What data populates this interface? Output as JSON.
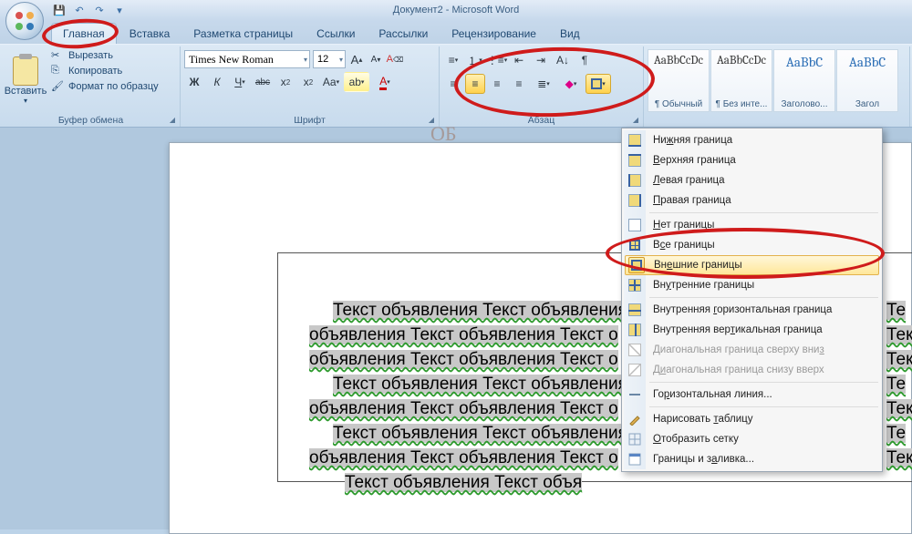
{
  "title": "Документ2 - Microsoft Word",
  "qat": {
    "save": "💾",
    "undo": "↶",
    "redo": "↷",
    "more": "▾",
    "spacer": "•"
  },
  "tabs": [
    "Главная",
    "Вставка",
    "Разметка страницы",
    "Ссылки",
    "Рассылки",
    "Рецензирование",
    "Вид"
  ],
  "active_tab": 0,
  "clipboard": {
    "paste": "Вставить",
    "cut": "Вырезать",
    "copy": "Копировать",
    "format_painter": "Формат по образцу",
    "label": "Буфер обмена"
  },
  "font": {
    "name": "Times New Roman",
    "size": "12",
    "grow": "A▴",
    "shrink": "A▾",
    "clear": "Aa",
    "bold": "Ж",
    "italic": "К",
    "underline": "Ч",
    "strike": "abc",
    "sub": "x₂",
    "sup": "x²",
    "case": "Aa",
    "highlight": "ab",
    "color": "A",
    "label": "Шрифт"
  },
  "para": {
    "label": "Абзац"
  },
  "styles": {
    "items": [
      {
        "preview": "AaBbCcDc",
        "label": "¶ Обычный"
      },
      {
        "preview": "AaBbCcDc",
        "label": "¶ Без инте..."
      },
      {
        "preview": "AaBbC",
        "label": "Заголово..."
      },
      {
        "preview": "AaBbC",
        "label": "Загол"
      }
    ]
  },
  "menu": {
    "items": [
      {
        "key": "bottom",
        "label_pre": "Ни",
        "label_u": "ж",
        "label_post": "няя граница"
      },
      {
        "key": "top",
        "label_pre": "",
        "label_u": "В",
        "label_post": "ерхняя граница"
      },
      {
        "key": "left",
        "label_pre": "",
        "label_u": "Л",
        "label_post": "евая граница"
      },
      {
        "key": "right",
        "label_pre": "",
        "label_u": "П",
        "label_post": "равая граница"
      },
      {
        "sep": true
      },
      {
        "key": "none",
        "label_pre": "",
        "label_u": "Н",
        "label_post": "ет границы"
      },
      {
        "key": "all",
        "label_pre": "В",
        "label_u": "с",
        "label_post": "е границы"
      },
      {
        "key": "outer",
        "label_pre": "Вн",
        "label_u": "е",
        "label_post": "шние границы",
        "hover": true
      },
      {
        "key": "inner",
        "label_pre": "Вн",
        "label_u": "у",
        "label_post": "тренние границы"
      },
      {
        "sep": true
      },
      {
        "key": "hmid",
        "label_pre": "Внутренняя ",
        "label_u": "г",
        "label_post": "оризонтальная граница"
      },
      {
        "key": "vmid",
        "label_pre": "Внутренняя вер",
        "label_u": "т",
        "label_post": "икальная граница"
      },
      {
        "key": "diagd",
        "label_pre": "Диагональная граница сверху вни",
        "label_u": "з",
        "label_post": "",
        "disabled": true
      },
      {
        "key": "diagu",
        "label_pre": "Д",
        "label_u": "и",
        "label_post": "агональная граница снизу вверх",
        "disabled": true
      },
      {
        "sep": true
      },
      {
        "key": "hline",
        "label_pre": "Го",
        "label_u": "р",
        "label_post": "изонтальная линия..."
      },
      {
        "sep": true
      },
      {
        "key": "draw",
        "label_pre": "Нарисовать ",
        "label_u": "т",
        "label_post": "аблицу"
      },
      {
        "key": "grid",
        "label_pre": "",
        "label_u": "О",
        "label_post": "тобразить сетку"
      },
      {
        "key": "dlg",
        "label_pre": "Границы и з",
        "label_u": "а",
        "label_post": "ливка..."
      }
    ]
  },
  "document": {
    "title_text": "ОБ",
    "lines": [
      "Текст объявления  Текст объявления",
      "объявления  Текст объявления  Текст о",
      "объявления  Текст объявления  Текст о",
      "Текст объявления  Текст объявления",
      "объявления  Текст объявления  Текст о",
      "Текст объявления  Текст объявления",
      "объявления  Текст объявления  Текст о",
      "Текст объявления  Текст объя"
    ],
    "lines_right": [
      "Те",
      "Текст",
      "Текст",
      "Те",
      "Текст",
      "Те",
      "Текст",
      ""
    ]
  }
}
